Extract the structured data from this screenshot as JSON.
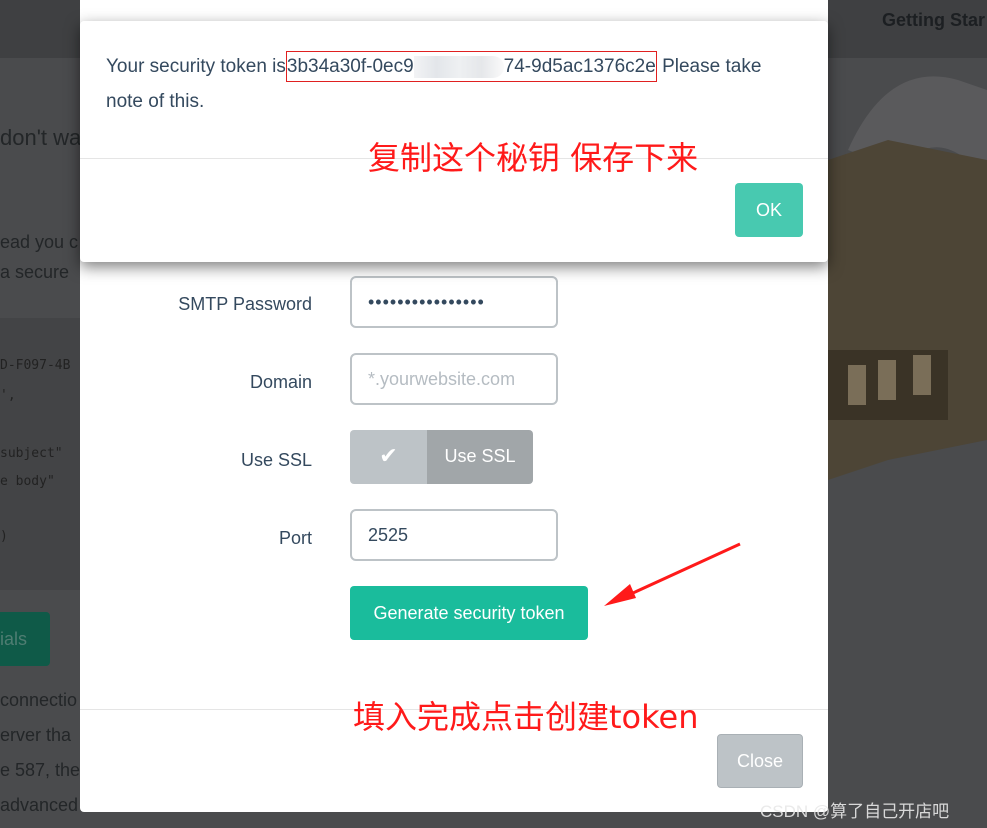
{
  "background": {
    "nav_item": "Getting Star",
    "fragments": [
      "don't wa",
      "ead you c",
      "a secure",
      "connectio",
      "erver tha",
      "e 587, the",
      "advanced"
    ],
    "code_fragments": [
      "D-F097-4B",
      "',",
      "subject\"",
      "e body\"",
      ")"
    ],
    "button_fragment": "ials"
  },
  "alert": {
    "message_prefix": "Your security token is",
    "token_start": "3b34a30f-0ec9",
    "token_end": "74-9d5ac1376c2e",
    "message_suffix": "Please take note of this.",
    "ok_label": "OK",
    "annotation": "复制这个秘钥 保存下来"
  },
  "form": {
    "smtp_password_label": "SMTP Password",
    "smtp_password_value": "••••••••••••••••",
    "domain_label": "Domain",
    "domain_placeholder": "*.yourwebsite.com",
    "use_ssl_label": "Use SSL",
    "use_ssl_toggle_text": "Use SSL",
    "use_ssl_checked": true,
    "port_label": "Port",
    "port_value": "2525",
    "generate_label": "Generate security token",
    "annotation": "填入完成点击创建token",
    "close_label": "Close"
  },
  "colors": {
    "primary": "#1abc9c",
    "ok": "#48c9b0",
    "annotation": "#ff1a1a",
    "disabled": "#bdc3c7"
  },
  "watermark": "CSDN @算了自己开店吧"
}
